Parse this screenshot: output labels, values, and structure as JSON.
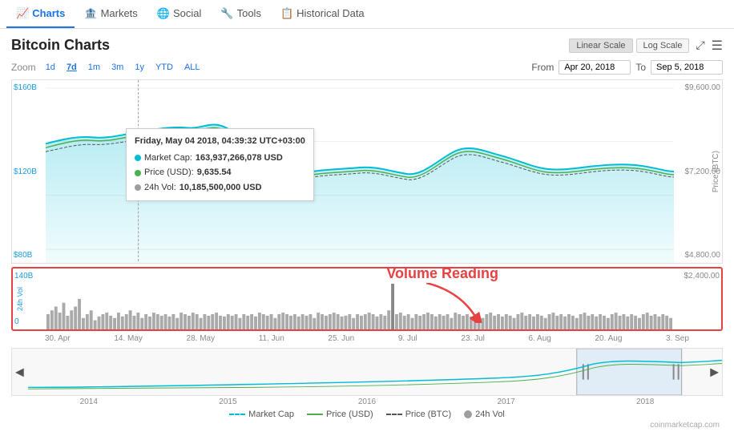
{
  "nav": {
    "items": [
      {
        "label": "Charts",
        "icon": "📈",
        "active": true
      },
      {
        "label": "Markets",
        "icon": "🏦",
        "active": false
      },
      {
        "label": "Social",
        "icon": "🌐",
        "active": false
      },
      {
        "label": "Tools",
        "icon": "🔧",
        "active": false
      },
      {
        "label": "Historical Data",
        "icon": "📋",
        "active": false
      }
    ]
  },
  "header": {
    "title": "Bitcoin Charts",
    "linear_scale": "Linear Scale",
    "log_scale": "Log Scale"
  },
  "zoom": {
    "label": "Zoom",
    "buttons": [
      "1d",
      "7d",
      "1m",
      "3m",
      "1y",
      "YTD",
      "ALL"
    ],
    "active": "7d",
    "from_label": "From",
    "to_label": "To",
    "from_date": "Apr 20, 2018",
    "to_date": "Sep 5, 2018"
  },
  "yaxis_left": [
    "$160B",
    "$120B",
    "$80B"
  ],
  "yaxis_right": [
    "$9,600.00",
    "$7,200.00",
    "$4,800.00"
  ],
  "vol_yaxis_left": [
    "140B",
    "0"
  ],
  "vol_yaxis_right": [
    "$2,400.00"
  ],
  "price_label": "Price (BTC)",
  "tooltip": {
    "title": "Friday, May 04 2018, 04:39:32 UTC+03:00",
    "market_cap_label": "Market Cap:",
    "market_cap_value": "163,937,266,078 USD",
    "price_usd_label": "Price (USD):",
    "price_usd_value": "9,635.54",
    "vol_label": "24h Vol:",
    "vol_value": "10,185,500,000 USD",
    "market_cap_color": "#00bcd4",
    "price_color": "#4caf50",
    "vol_color": "#9e9e9e"
  },
  "volume_annotation": "Volume Reading",
  "xaxis_labels": [
    "30. Apr",
    "14. May",
    "28. May",
    "11. Jun",
    "25. Jun",
    "9. Jul",
    "23. Jul",
    "6. Aug",
    "20. Aug",
    "3. Sep"
  ],
  "mini_xaxis_labels": [
    "2014",
    "2015",
    "2016",
    "2017",
    "2018"
  ],
  "legend": [
    {
      "label": "Market Cap",
      "color": "#00bcd4",
      "style": "dashed"
    },
    {
      "label": "Price (USD)",
      "color": "#4caf50",
      "style": "solid"
    },
    {
      "label": "Price (BTC)",
      "color": "#333",
      "style": "dashed"
    },
    {
      "label": "24h Vol",
      "color": "#9e9e9e",
      "style": "solid"
    }
  ],
  "credit": "coinmarketcap.com"
}
